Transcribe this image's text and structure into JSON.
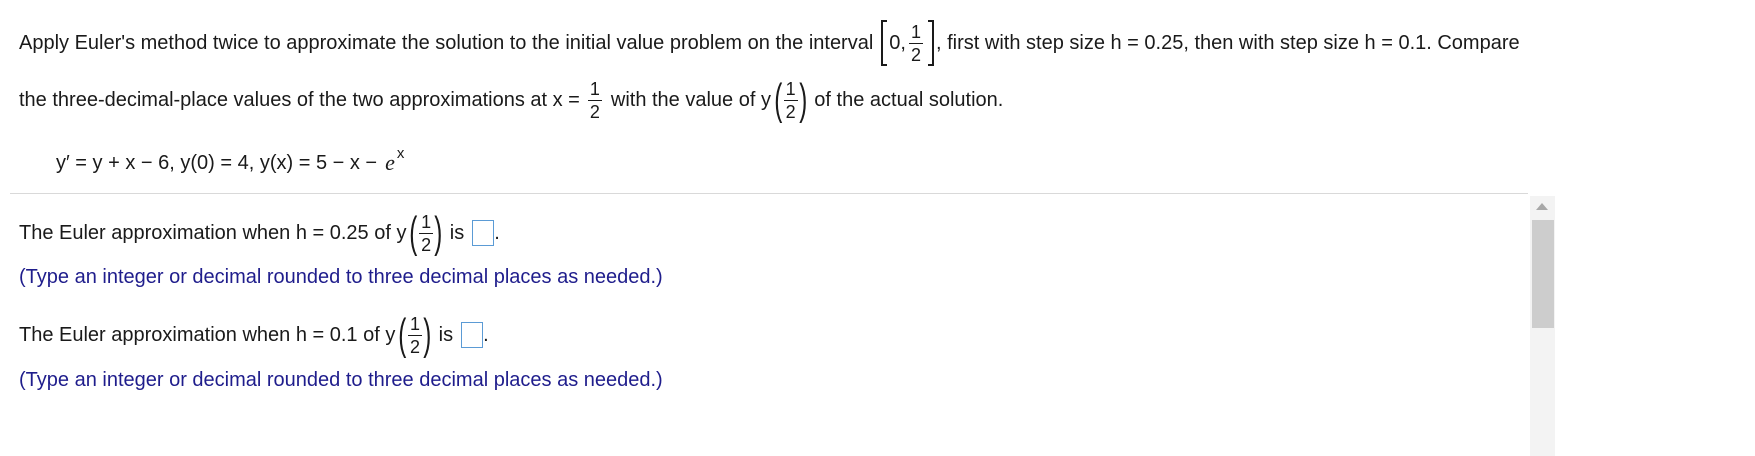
{
  "problem": {
    "line1_pre": "Apply Euler's method twice to approximate the solution to the initial value problem on the interval",
    "interval_start": "0,",
    "frac_num": "1",
    "frac_den": "2",
    "line1_post": ", first with step size h = 0.25, then with step size h = 0.1. Compare",
    "line2_pre": "the three-decimal-place values of the two approximations at x =",
    "line2_mid": "with the value of y",
    "line2_post": "of the actual solution.",
    "equation_text": "y′ = y + x − 6, y(0) = 4, y(x) = 5 − x −",
    "equation_e": "e",
    "equation_exp": "x"
  },
  "question1": {
    "text_pre": "The Euler approximation when h = 0.25 of y",
    "text_is": "is",
    "hint": "(Type an integer or decimal rounded to three decimal places as needed.)",
    "answer_value": ""
  },
  "question2": {
    "text_pre": "The Euler approximation when h = 0.1 of y",
    "text_is": "is",
    "hint": "(Type an integer or decimal rounded to three decimal places as needed.)",
    "answer_value": ""
  },
  "colors": {
    "hint_text": "#1f1d8c",
    "answer_box_border": "#5b9bd5",
    "divider": "#d9d9d9"
  },
  "icons": {
    "scroll_up": "triangle-up"
  }
}
